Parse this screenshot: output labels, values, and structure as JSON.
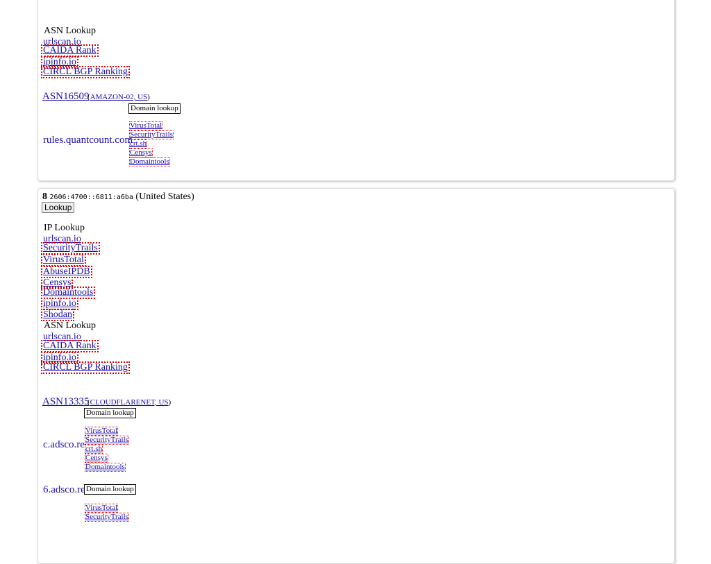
{
  "card1": {
    "asn_header": "ASN Lookup",
    "asn_links": [
      "urlscan.io",
      "CAIDA Rank",
      "ipinfo.io",
      "CIRCL BGP Ranking"
    ],
    "asn": "ASN16509",
    "asn_owner": "AMAZON-02, US",
    "domains": [
      {
        "name": "rules.quantcount.com",
        "button": "Domain lookup",
        "links": [
          "VirusTotal",
          "SecurityTrails",
          "crt.sh",
          "Censys",
          "Domaintools"
        ]
      }
    ]
  },
  "card2": {
    "index": "8",
    "ip": "2606:4700::6811:a6ba",
    "country": "(United States)",
    "lookup_button": "Lookup",
    "ip_header": "IP Lookup",
    "ip_links": [
      "urlscan.io",
      "SecurityTrails",
      "VirusTotal",
      "AbuseIPDB",
      "Censys",
      "Domaintools",
      "ipinfo.io",
      "Shodan"
    ],
    "asn_header": "ASN Lookup",
    "asn_links": [
      "urlscan.io",
      "CAIDA Rank",
      "ipinfo.io",
      "CIRCL BGP Ranking"
    ],
    "asn": "ASN13335",
    "asn_owner": "CLOUDFLARENET, US",
    "domains": [
      {
        "name": "c.adsco.re",
        "button": "Domain lookup",
        "links": [
          "VirusTotal",
          "SecurityTrails",
          "crt.sh",
          "Censys",
          "Domaintools"
        ]
      },
      {
        "name": "6.adsco.re",
        "button": "Domain lookup",
        "links": [
          "VirusTotal",
          "SecurityTrails"
        ]
      }
    ]
  }
}
